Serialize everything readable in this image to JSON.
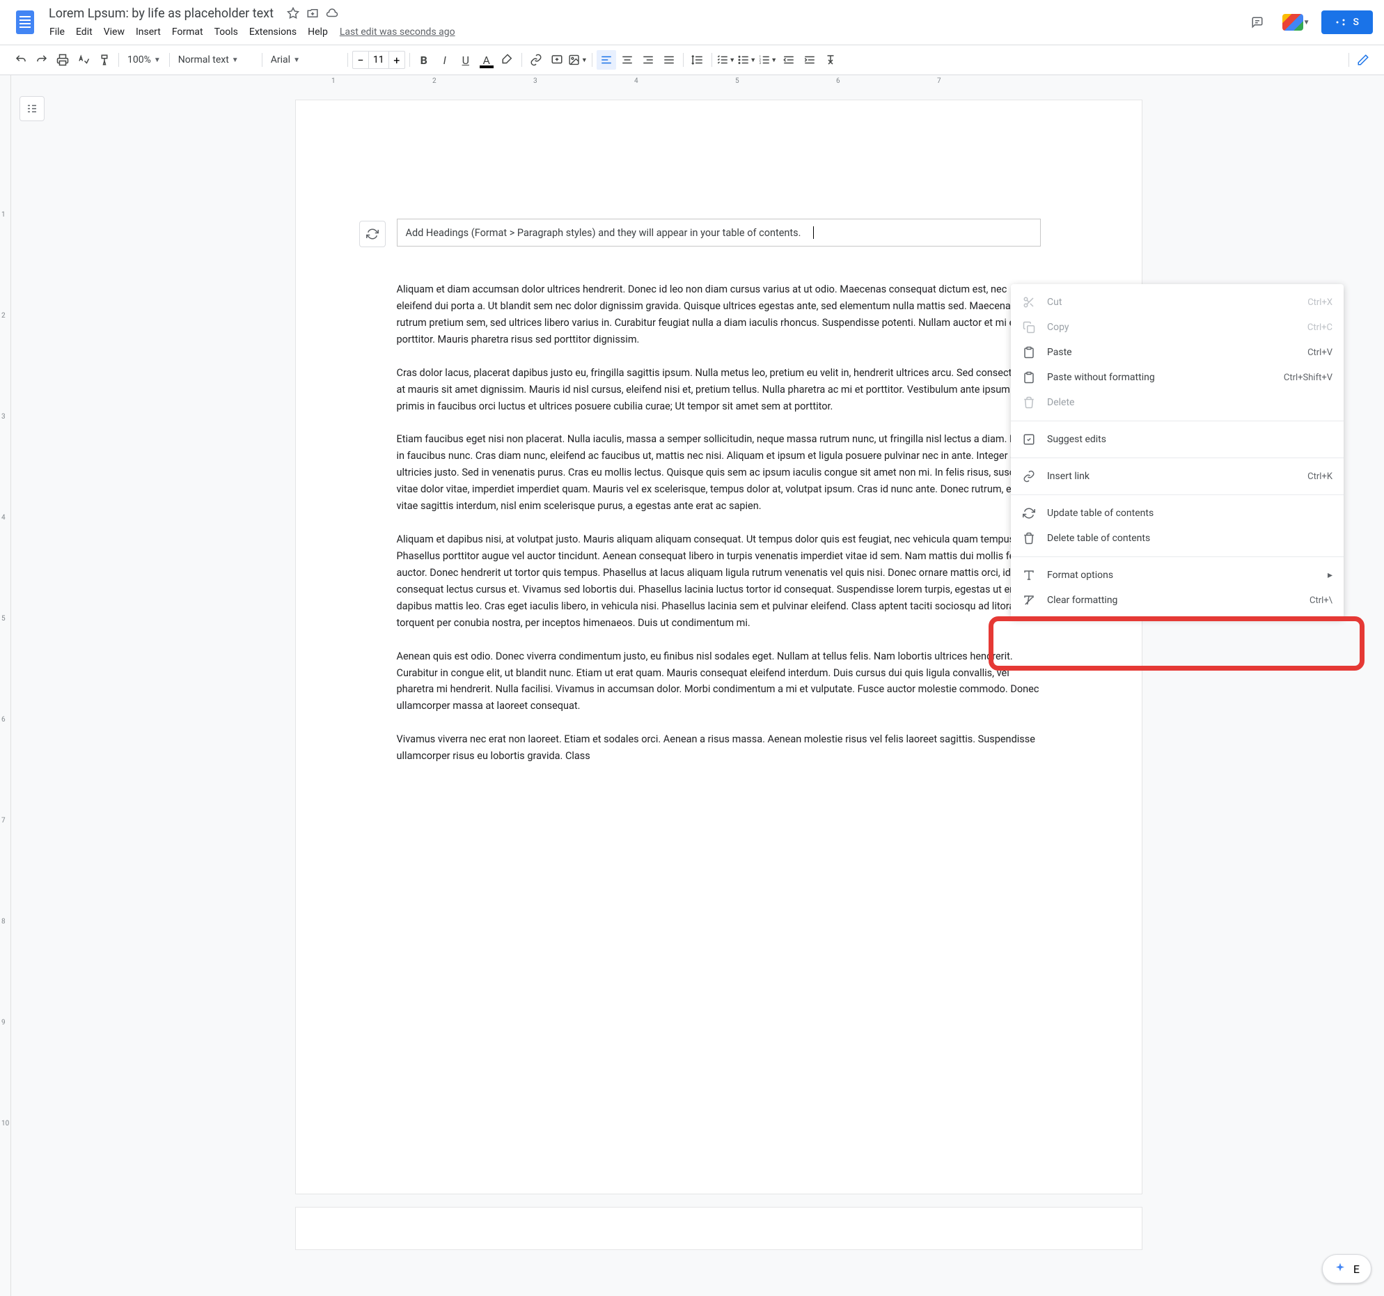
{
  "header": {
    "title": "Lorem Lpsum: by life as placeholder text",
    "last_edit": "Last edit was seconds ago"
  },
  "menubar": [
    "File",
    "Edit",
    "View",
    "Insert",
    "Format",
    "Tools",
    "Extensions",
    "Help"
  ],
  "share_label": "S",
  "toolbar": {
    "zoom": "100%",
    "style": "Normal text",
    "font": "Arial",
    "font_size": "11"
  },
  "ruler_h": [
    "1",
    "2",
    "3",
    "4",
    "5",
    "6",
    "7"
  ],
  "ruler_v": [
    "1",
    "2",
    "3",
    "4",
    "5",
    "6",
    "7",
    "8",
    "9",
    "10"
  ],
  "toc": {
    "hint": "Add Headings (Format > Paragraph styles) and they will appear in your table of contents."
  },
  "paragraphs": [
    "Aliquam et diam accumsan dolor ultrices hendrerit. Donec id leo non diam cursus varius at ut odio. Maecenas consequat dictum est, nec eleifend dui porta a. Ut blandit sem nec dolor dignissim gravida. Quisque ultrices egestas ante, sed elementum nulla mattis sed. Maecenas rutrum pretium sem, sed ultrices libero varius in. Curabitur feugiat nulla a diam iaculis rhoncus. Suspendisse potenti. Nullam auctor et mi eget porttitor. Mauris pharetra risus sed porttitor dignissim.",
    "Cras dolor lacus, placerat dapibus justo eu, fringilla sagittis ipsum. Nulla metus leo, pretium eu velit in, hendrerit ultrices arcu. Sed consectetur at mauris sit amet dignissim. Mauris id nisl cursus, eleifend nisi et, pretium tellus. Nulla pharetra ac mi et porttitor. Vestibulum ante ipsum primis in faucibus orci luctus et ultrices posuere cubilia curae; Ut tempor sit amet sem at porttitor.",
    "Etiam faucibus eget nisi non placerat. Nulla iaculis, massa a semper sollicitudin, neque massa rutrum nunc, ut fringilla nisl lectus a diam. Donec in faucibus nunc. Cras diam nunc, eleifend ac faucibus ut, mattis nec nisi. Aliquam et ipsum et ligula posuere pulvinar nec in ante. Integer sed ultricies justo. Sed in venenatis purus. Cras eu mollis lectus. Quisque quis sem ac ipsum iaculis congue sit amet non mi. In felis risus, suscipit vitae dolor vitae, imperdiet imperdiet quam. Mauris vel ex scelerisque, tempus dolor at, volutpat ipsum. Cras id nunc ante. Donec rutrum, elit vitae sagittis interdum, nisl enim scelerisque purus, a egestas ante erat ac sapien.",
    "Aliquam et dapibus nisi, at volutpat justo. Mauris aliquam aliquam consequat. Ut tempus dolor quis est feugiat, nec vehicula quam tempus. Phasellus porttitor augue vel auctor tincidunt. Aenean consequat libero in turpis venenatis imperdiet vitae id sem. Nam mattis dui mollis feugiat auctor. Donec hendrerit ut tortor quis tempus. Phasellus at lacus aliquam ligula rutrum venenatis vel quis nisi. Donec ornare mattis orci, id consequat lectus cursus et. Vivamus sed lobortis dui. Phasellus lacinia luctus tortor id consequat. Suspendisse lorem turpis, egestas ut erat a, dapibus mattis leo. Cras eget iaculis libero, in vehicula nisi. Phasellus lacinia sem et pulvinar eleifend. Class aptent taciti sociosqu ad litora torquent per conubia nostra, per inceptos himenaeos. Duis ut condimentum mi.",
    "Aenean quis est odio. Donec viverra condimentum justo, eu finibus nisl sodales eget. Nullam at tellus felis. Nam lobortis ultrices hendrerit. Curabitur in congue elit, ut blandit nunc. Etiam ut erat quam. Mauris consequat eleifend interdum. Duis cursus dui quis ligula convallis, vel pharetra mi hendrerit. Nulla facilisi. Vivamus in accumsan dolor. Morbi condimentum a mi et vulputate. Fusce auctor molestie commodo. Donec ullamcorper massa at laoreet consequat.",
    "Vivamus viverra nec erat non laoreet. Etiam et sodales orci. Aenean a risus massa. Aenean molestie risus vel felis laoreet sagittis. Suspendisse ullamcorper risus eu lobortis gravida. Class"
  ],
  "context_menu": {
    "cut": "Cut",
    "cut_sc": "Ctrl+X",
    "copy": "Copy",
    "copy_sc": "Ctrl+C",
    "paste": "Paste",
    "paste_sc": "Ctrl+V",
    "paste_nf": "Paste without formatting",
    "paste_nf_sc": "Ctrl+Shift+V",
    "delete": "Delete",
    "suggest": "Suggest edits",
    "insert_link": "Insert link",
    "insert_link_sc": "Ctrl+K",
    "update_toc": "Update table of contents",
    "delete_toc": "Delete table of contents",
    "format_opts": "Format options",
    "clear_fmt": "Clear formatting",
    "clear_fmt_sc": "Ctrl+\\"
  },
  "explore_label": "E"
}
